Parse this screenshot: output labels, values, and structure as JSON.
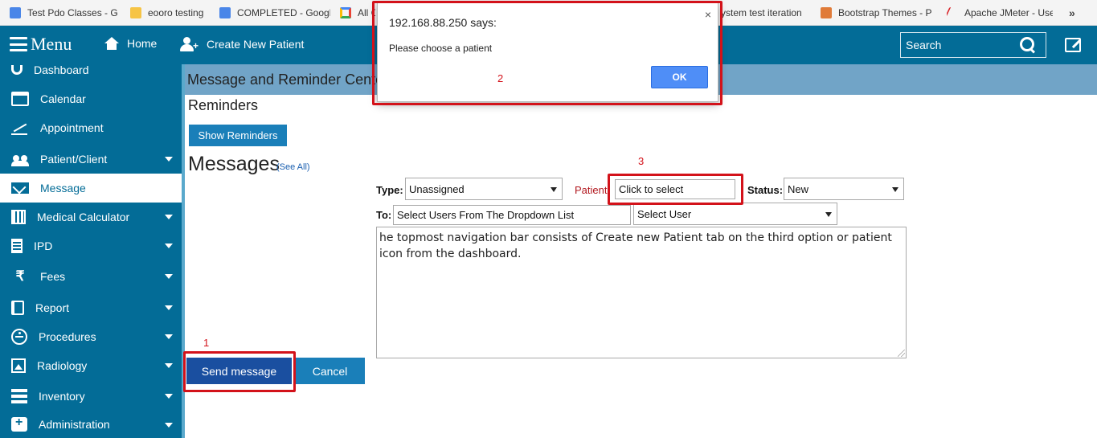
{
  "browser": {
    "bookmarks": [
      {
        "label": "Test Pdo Classes - Go",
        "icon": "doc-icon"
      },
      {
        "label": "eooro testing",
        "icon": "folder-icon"
      },
      {
        "label": "COMPLETED - Google",
        "icon": "doc-icon"
      },
      {
        "label": "All C",
        "icon": "google-icon"
      },
      {
        "label": "ystem test iteration",
        "icon": "doc-icon"
      },
      {
        "label": "Bootstrap Themes - P",
        "icon": "bootstrap-icon"
      },
      {
        "label": "Apache JMeter - User",
        "icon": "jmeter-icon"
      }
    ],
    "more": "»"
  },
  "navbar": {
    "menu_label": "Menu",
    "home_label": "Home",
    "create_patient_label": "Create New Patient",
    "search_placeholder": "Search",
    "bar_color": "#036c97"
  },
  "sidebar": {
    "items": [
      {
        "label": "Dashboard",
        "icon": "stethoscope-icon",
        "caret": false
      },
      {
        "label": "Calendar",
        "icon": "calendar-icon",
        "caret": false
      },
      {
        "label": "Appointment",
        "icon": "line-chart-icon",
        "caret": false
      },
      {
        "label": "Patient/Client",
        "icon": "users-icon",
        "caret": true
      },
      {
        "label": "Message",
        "icon": "envelope-icon",
        "caret": false,
        "active": true
      },
      {
        "label": "Medical Calculator",
        "icon": "calculator-icon",
        "caret": true
      },
      {
        "label": "IPD",
        "icon": "building-icon",
        "caret": true
      },
      {
        "label": "Fees",
        "icon": "rupee-icon",
        "caret": true
      },
      {
        "label": "Report",
        "icon": "book-icon",
        "caret": true
      },
      {
        "label": "Procedures",
        "icon": "accessibility-icon",
        "caret": true
      },
      {
        "label": "Radiology",
        "icon": "image-icon",
        "caret": true
      },
      {
        "label": "Inventory",
        "icon": "list-icon",
        "caret": true
      },
      {
        "label": "Administration",
        "icon": "medkit-icon",
        "caret": true
      }
    ]
  },
  "main": {
    "page_title": "Message and Reminder Cente",
    "reminders_title": "Reminders",
    "show_reminders_label": "Show Reminders",
    "messages_title": "Messages",
    "see_all": "(See All)",
    "type_label": "Type:",
    "type_value": "Unassigned",
    "patient_label": "Patient:",
    "patient_value": "Click to select",
    "status_label": "Status:",
    "status_value": "New",
    "to_label": "To:",
    "to_value": "Select Users From The Dropdown List",
    "user_select_value": "Select User",
    "message_text": "he topmost navigation bar consists of Create new Patient tab on the third option or patient icon from the dashboard.",
    "send_label": "Send message",
    "cancel_label": "Cancel"
  },
  "annotations": {
    "one": "1",
    "two": "2",
    "three": "3",
    "color": "#d3121a"
  },
  "dialog": {
    "title": "192.168.88.250 says:",
    "message": "Please choose a patient",
    "close": "×",
    "ok_label": "OK"
  }
}
